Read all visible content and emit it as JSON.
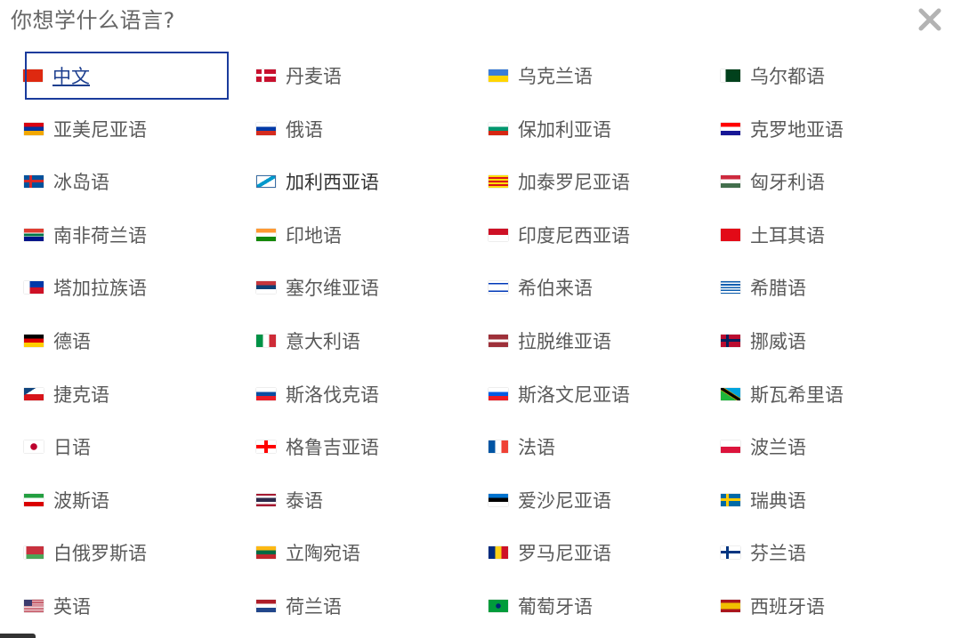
{
  "dialog": {
    "title": "你想学什么语言?",
    "close_label": "✕"
  },
  "languages": [
    {
      "label": "中文",
      "flag": "cn",
      "state": "selected"
    },
    {
      "label": "丹麦语",
      "flag": "dk"
    },
    {
      "label": "乌克兰语",
      "flag": "ua"
    },
    {
      "label": "乌尔都语",
      "flag": "pk"
    },
    {
      "label": "亚美尼亚语",
      "flag": "am"
    },
    {
      "label": "俄语",
      "flag": "ru"
    },
    {
      "label": "保加利亚语",
      "flag": "bg"
    },
    {
      "label": "克罗地亚语",
      "flag": "hr"
    },
    {
      "label": "冰岛语",
      "flag": "is"
    },
    {
      "label": "加利西亚语",
      "flag": "gl",
      "state": "hover"
    },
    {
      "label": "加泰罗尼亚语",
      "flag": "ct"
    },
    {
      "label": "匈牙利语",
      "flag": "hu"
    },
    {
      "label": "南非荷兰语",
      "flag": "za"
    },
    {
      "label": "印地语",
      "flag": "in"
    },
    {
      "label": "印度尼西亚语",
      "flag": "id"
    },
    {
      "label": "土耳其语",
      "flag": "tr"
    },
    {
      "label": "塔加拉族语",
      "flag": "ph"
    },
    {
      "label": "塞尔维亚语",
      "flag": "rs"
    },
    {
      "label": "希伯来语",
      "flag": "il"
    },
    {
      "label": "希腊语",
      "flag": "gr"
    },
    {
      "label": "德语",
      "flag": "de"
    },
    {
      "label": "意大利语",
      "flag": "it"
    },
    {
      "label": "拉脱维亚语",
      "flag": "lv"
    },
    {
      "label": "挪威语",
      "flag": "no"
    },
    {
      "label": "捷克语",
      "flag": "cz"
    },
    {
      "label": "斯洛伐克语",
      "flag": "sk"
    },
    {
      "label": "斯洛文尼亚语",
      "flag": "si"
    },
    {
      "label": "斯瓦希里语",
      "flag": "tz"
    },
    {
      "label": "日语",
      "flag": "jp"
    },
    {
      "label": "格鲁吉亚语",
      "flag": "ge"
    },
    {
      "label": "法语",
      "flag": "fr"
    },
    {
      "label": "波兰语",
      "flag": "pl"
    },
    {
      "label": "波斯语",
      "flag": "ir"
    },
    {
      "label": "泰语",
      "flag": "th"
    },
    {
      "label": "爱沙尼亚语",
      "flag": "ee"
    },
    {
      "label": "瑞典语",
      "flag": "se"
    },
    {
      "label": "白俄罗斯语",
      "flag": "by"
    },
    {
      "label": "立陶宛语",
      "flag": "lt"
    },
    {
      "label": "罗马尼亚语",
      "flag": "ro"
    },
    {
      "label": "芬兰语",
      "flag": "fi"
    },
    {
      "label": "英语",
      "flag": "us"
    },
    {
      "label": "荷兰语",
      "flag": "nl"
    },
    {
      "label": "葡萄牙语",
      "flag": "br"
    },
    {
      "label": "西班牙语",
      "flag": "es"
    }
  ],
  "colors": {
    "selected_border": "#1a3b9c",
    "selected_text": "#1d3f8f",
    "text": "#595959",
    "title": "#666666",
    "close": "#b3b3b3"
  }
}
